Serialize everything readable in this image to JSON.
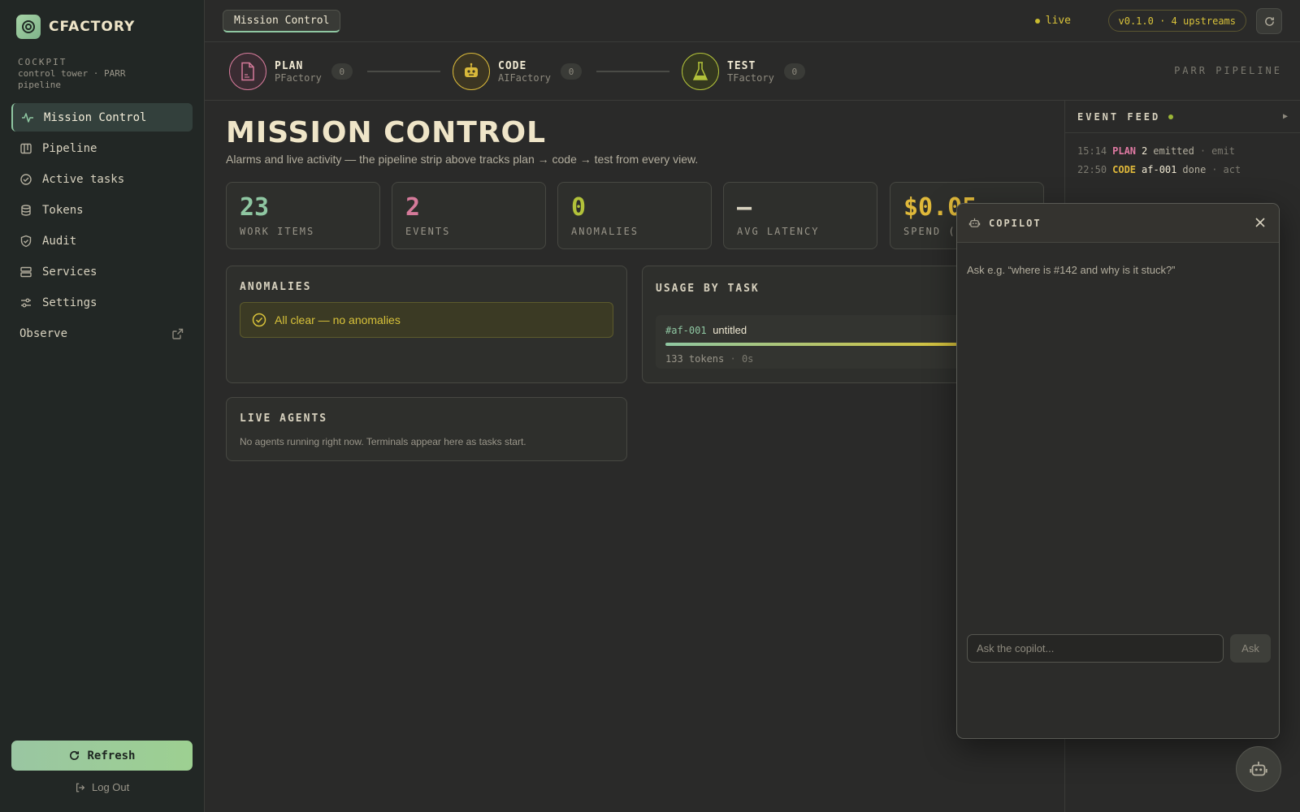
{
  "brand": {
    "name": "CFACTORY"
  },
  "cockpit": {
    "label": "COCKPIT",
    "desc": "control tower · PARR pipeline"
  },
  "sidebar": {
    "items": [
      {
        "label": "Mission Control",
        "icon": "activity-icon"
      },
      {
        "label": "Pipeline",
        "icon": "kanban-icon"
      },
      {
        "label": "Active tasks",
        "icon": "check-circle-icon"
      },
      {
        "label": "Tokens",
        "icon": "database-icon"
      },
      {
        "label": "Audit",
        "icon": "shield-check-icon"
      },
      {
        "label": "Services",
        "icon": "server-icon"
      },
      {
        "label": "Settings",
        "icon": "sliders-icon"
      },
      {
        "label": "Observe",
        "icon": "external-link-icon"
      }
    ],
    "refresh_label": "Refresh",
    "logout_label": "Log Out"
  },
  "topbar": {
    "tab": "Mission Control",
    "live": "live",
    "version": "v0.1.0 · 4 upstreams"
  },
  "pipeline": {
    "stages": [
      {
        "name": "PLAN",
        "sub": "PFactory",
        "count": "0",
        "color": "#d57a9a"
      },
      {
        "name": "CODE",
        "sub": "AIFactory",
        "count": "0",
        "color": "#d8b83a"
      },
      {
        "name": "TEST",
        "sub": "TFactory",
        "count": "0",
        "color": "#b2c23a"
      }
    ],
    "label": "PARR PIPELINE"
  },
  "main": {
    "title": "MISSION CONTROL",
    "subtitle": "Alarms and live activity — the pipeline strip above tracks plan → code → test from every view.",
    "stats": [
      {
        "value": "23",
        "label": "WORK ITEMS",
        "color": "#8fc7a2"
      },
      {
        "value": "2",
        "label": "EVENTS",
        "color": "#d57a9a"
      },
      {
        "value": "0",
        "label": "ANOMALIES",
        "color": "#b2c23a"
      },
      {
        "value": "—",
        "label": "AVG LATENCY",
        "color": "#d8d2bf"
      },
      {
        "value": "$0.05",
        "label": "SPEND (U",
        "color": "#e0b93a"
      }
    ],
    "anomalies": {
      "title": "ANOMALIES",
      "status": "All clear — no anomalies"
    },
    "usage": {
      "title": "USAGE BY TASK",
      "task_id": "#af-001",
      "task_name": "untitled",
      "tokens": "133 tokens",
      "time": "0s"
    },
    "agents": {
      "title": "LIVE AGENTS",
      "empty": "No agents running right now. Terminals appear here as tasks start."
    }
  },
  "feed": {
    "title": "EVENT FEED",
    "events": [
      {
        "time": "15:14",
        "stage": "PLAN",
        "stage_color": "#e07aa3",
        "subject": "2",
        "verb": "emitted",
        "kind": "emit"
      },
      {
        "time": "22:50",
        "stage": "CODE",
        "stage_color": "#e0b93a",
        "subject": "af-001",
        "verb": "done",
        "kind": "act"
      }
    ]
  },
  "copilot": {
    "title": "COPILOT",
    "hint": "Ask e.g. “where is #142 and why is it stuck?”",
    "placeholder": "Ask the copilot...",
    "ask_label": "Ask"
  }
}
